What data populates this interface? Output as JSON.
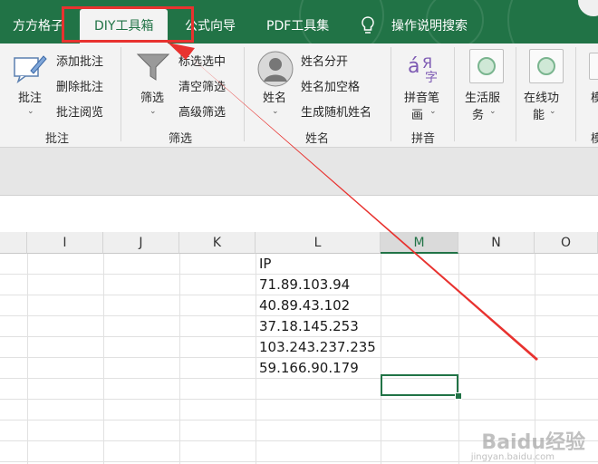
{
  "tabs": [
    "方方格子",
    "DIY工具箱",
    "公式向导",
    "PDF工具集",
    "操作说明搜索"
  ],
  "ribbon": {
    "annotate": {
      "big_label": "批注",
      "items": [
        "添加批注",
        "删除批注",
        "批注阅览"
      ],
      "group": "批注"
    },
    "filter": {
      "big_label": "筛选",
      "items": [
        "标选选中",
        "清空筛选",
        "高级筛选"
      ],
      "group": "筛选"
    },
    "name": {
      "big_label": "姓名",
      "items": [
        "姓名分开",
        "姓名加空格",
        "生成随机姓名"
      ],
      "group": "姓名"
    },
    "pinyin": {
      "big_label_line1": "拼音笔",
      "big_label_line2": "画",
      "group": "拼音"
    },
    "life": {
      "line1": "生活服",
      "line2": "务"
    },
    "online": {
      "line1": "在线功",
      "line2": "能"
    },
    "partial": {
      "label": "模",
      "group": "模"
    }
  },
  "columns": [
    "I",
    "J",
    "K",
    "L",
    "M",
    "N",
    "O"
  ],
  "selected_column": "M",
  "cells": [
    "IP",
    "71.89.103.94",
    "40.89.43.102",
    "37.18.145.253",
    "103.243.237.235",
    "59.166.90.179"
  ],
  "watermark": {
    "brand": "Baidu经验",
    "url": "jingyan.baidu.com"
  },
  "colors": {
    "green": "#217346",
    "annotation_red": "#e8322f"
  }
}
